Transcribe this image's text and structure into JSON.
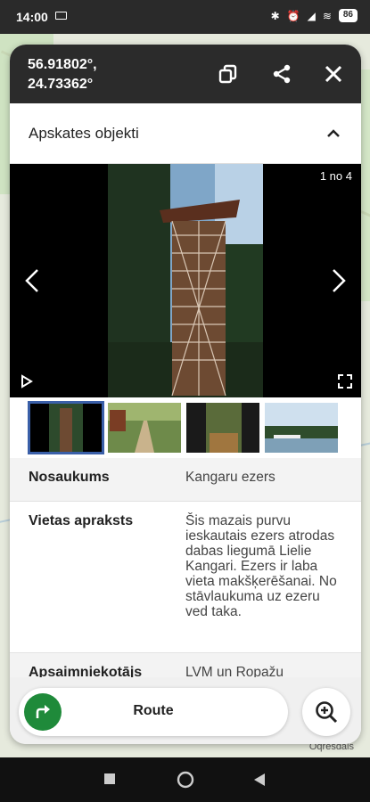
{
  "status_bar": {
    "time": "14:00",
    "battery": "86"
  },
  "header": {
    "coordinates": "56.91802°,\n24.73362°"
  },
  "section": {
    "title": "Apskates objekti"
  },
  "gallery": {
    "counter": "1 no 4"
  },
  "details": [
    {
      "label": "Nosaukums",
      "value": "Kangaru ezers"
    },
    {
      "label": "Vietas apraksts",
      "value": "Šis mazais purvu ieskautais ezers atrodas dabas liegumā Lielie Kangari. Ezers ir laba vieta makšķerēšanai. No stāvlaukuma uz ezeru ved taka."
    },
    {
      "label": "Apsaimniekotājs",
      "value": "LVM un Ropažu"
    }
  ],
  "actions": {
    "route_label": "Route"
  },
  "map": {
    "label": "Oqresdals"
  },
  "colors": {
    "accent_green": "#1f8a3a",
    "header_bg": "#2b2b2b",
    "thumb_selected": "#3a5fa8"
  }
}
